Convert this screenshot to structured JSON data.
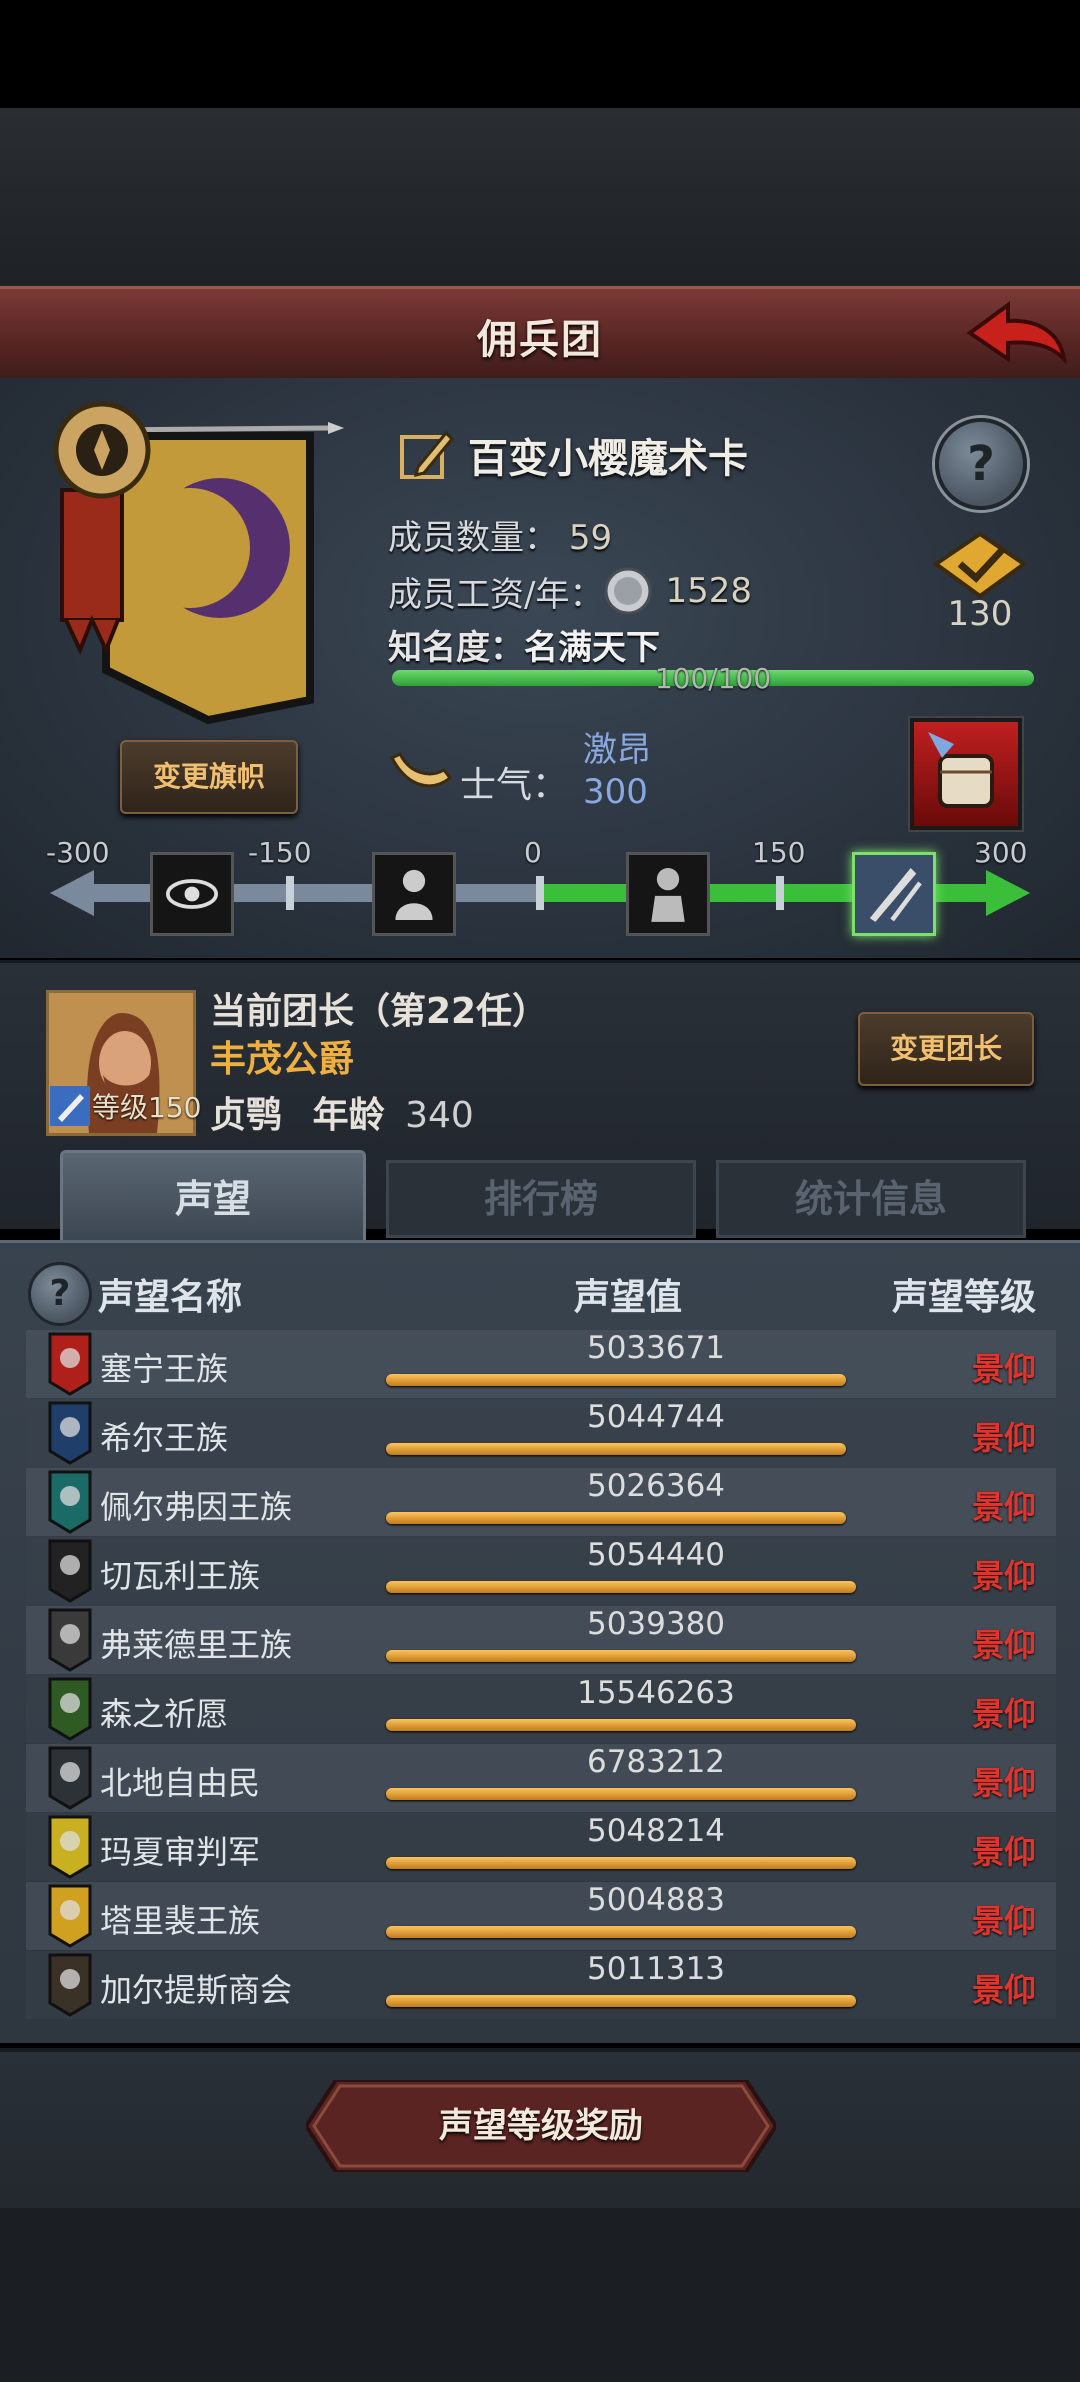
{
  "header": {
    "title": "佣兵团"
  },
  "guild": {
    "name": "百变小樱魔术卡",
    "members_label": "成员数量：",
    "members_value": "59",
    "wage_label": "成员工资/年：",
    "wage_value": "1528",
    "fame_label": "知名度：",
    "fame_value": "名满天下",
    "fame_progress_text": "100/100",
    "fame_progress": 1.0,
    "rank_value": "130",
    "change_flag_label": "变更旗帜"
  },
  "morale": {
    "label": "士气：",
    "state": "激昂",
    "value": "300",
    "scale": [
      "-300",
      "-150",
      "0",
      "150",
      "300"
    ],
    "level_fraction": 1.0
  },
  "leader": {
    "title": "当前团长（第22任）",
    "name": "丰茂公爵",
    "level_text": "等级150",
    "trait": "贞鹗",
    "age_label": "年龄",
    "age_value": "340",
    "change_leader_label": "变更团长"
  },
  "tabs": [
    {
      "label": "声望"
    },
    {
      "label": "排行榜"
    },
    {
      "label": "统计信息"
    }
  ],
  "table": {
    "col_name": "声望名称",
    "col_value": "声望值",
    "col_level": "声望等级",
    "rows": [
      {
        "name": "塞宁王族",
        "value": "5033671",
        "level": "景仰",
        "fill": 0.92,
        "color": "#b0201a"
      },
      {
        "name": "希尔王族",
        "value": "5044744",
        "level": "景仰",
        "fill": 0.92,
        "color": "#1f3f6a"
      },
      {
        "name": "佩尔弗因王族",
        "value": "5026364",
        "level": "景仰",
        "fill": 0.92,
        "color": "#1a6a66"
      },
      {
        "name": "切瓦利王族",
        "value": "5054440",
        "level": "景仰",
        "fill": 0.94,
        "color": "#222222"
      },
      {
        "name": "弗莱德里王族",
        "value": "5039380",
        "level": "景仰",
        "fill": 0.94,
        "color": "#3a3a3a"
      },
      {
        "name": "森之祈愿",
        "value": "15546263",
        "level": "景仰",
        "fill": 0.94,
        "color": "#2f5a24"
      },
      {
        "name": "北地自由民",
        "value": "6783212",
        "level": "景仰",
        "fill": 0.94,
        "color": "#2c3236"
      },
      {
        "name": "玛夏审判军",
        "value": "5048214",
        "level": "景仰",
        "fill": 0.94,
        "color": "#c8b020"
      },
      {
        "name": "塔里裴王族",
        "value": "5004883",
        "level": "景仰",
        "fill": 0.94,
        "color": "#d0a020"
      },
      {
        "name": "加尔提斯商会",
        "value": "5011313",
        "level": "景仰",
        "fill": 0.94,
        "color": "#3a3226"
      }
    ]
  },
  "footer": {
    "reward_label": "声望等级奖励"
  }
}
